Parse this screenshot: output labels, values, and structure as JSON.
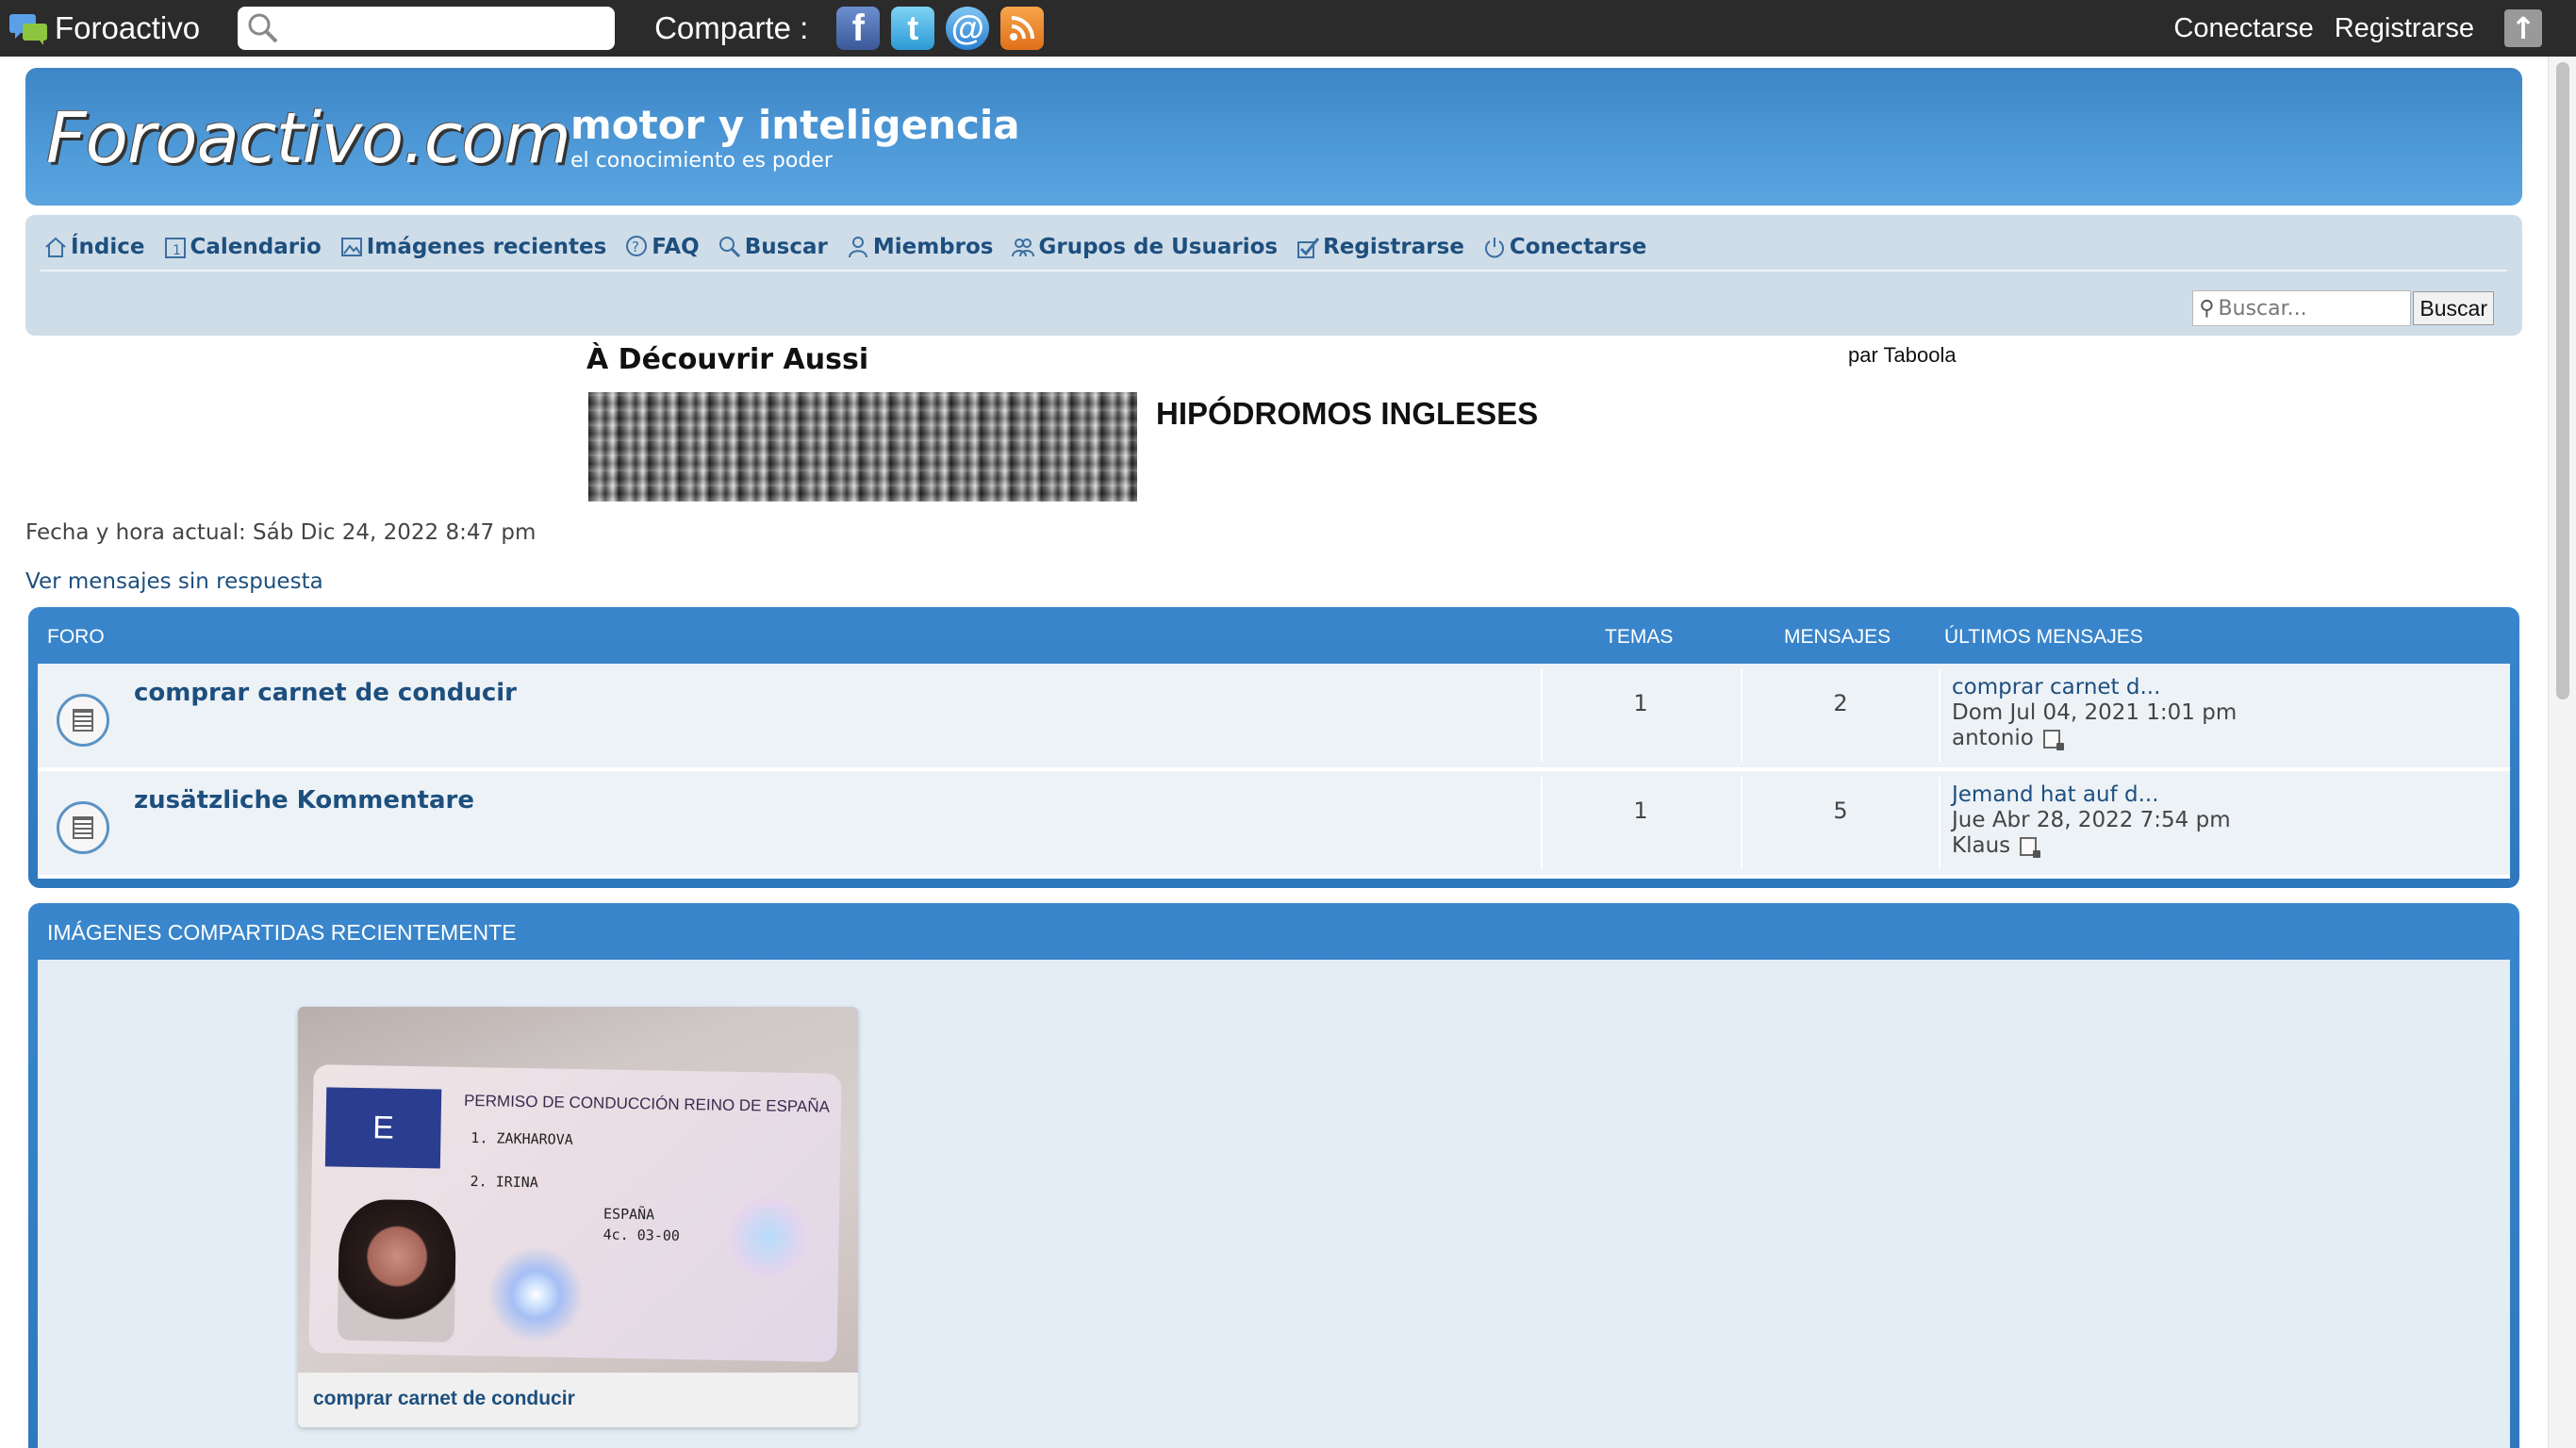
{
  "topbar": {
    "brand": "Foroactivo",
    "share_label": "Comparte :",
    "social": [
      "facebook-icon",
      "twitter-icon",
      "email-icon",
      "rss-icon"
    ],
    "login": "Conectarse",
    "register": "Registrarse"
  },
  "header": {
    "logo": "Foroactivo.com",
    "title": "motor y inteligencia",
    "subtitle": "el conocimiento es poder"
  },
  "nav": {
    "items": [
      {
        "label": "Índice",
        "icon": "home-icon"
      },
      {
        "label": "Calendario",
        "icon": "calendar-icon"
      },
      {
        "label": "Imágenes recientes",
        "icon": "image-icon"
      },
      {
        "label": "FAQ",
        "icon": "help-icon"
      },
      {
        "label": "Buscar",
        "icon": "search-icon"
      },
      {
        "label": "Miembros",
        "icon": "member-icon"
      },
      {
        "label": "Grupos de Usuarios",
        "icon": "group-icon"
      },
      {
        "label": "Registrarse",
        "icon": "register-icon"
      },
      {
        "label": "Conectarse",
        "icon": "power-icon"
      }
    ],
    "search_placeholder": "Buscar...",
    "search_button": "Buscar"
  },
  "taboola": {
    "title": "À Découvrir Aussi",
    "by": "par Taboola",
    "headline": "HIPÓDROMOS INGLESES"
  },
  "current_time": "Fecha y hora actual: Sáb Dic 24, 2022 8:47 pm",
  "unanswered_link": "Ver mensajes sin respuesta",
  "forum": {
    "headers": {
      "forum": "FORO",
      "topics": "TEMAS",
      "posts": "MENSAJES",
      "last": "ÚLTIMOS MENSAJES"
    },
    "rows": [
      {
        "title": "comprar carnet de conducir",
        "topics": "1",
        "posts": "2",
        "last_title": "comprar carnet d...",
        "last_date": "Dom Jul 04, 2021 1:01 pm",
        "last_user": "antonio"
      },
      {
        "title": "zusätzliche Kommentare",
        "topics": "1",
        "posts": "5",
        "last_title": "Jemand hat auf d...",
        "last_date": "Jue Abr 28, 2022 7:54 pm",
        "last_user": "Klaus"
      }
    ]
  },
  "images": {
    "heading": "IMÁGENES COMPARTIDAS RECIENTEMENTE",
    "caption": "comprar carnet de conducir",
    "card": {
      "flag": "E",
      "header": "PERMISO DE CONDUCCIÓN REINO DE ESPAÑA",
      "lines": [
        "1. ZAKHAROVA",
        "2. IRINA",
        "ESPAÑA",
        "4c. 03-00"
      ]
    }
  }
}
